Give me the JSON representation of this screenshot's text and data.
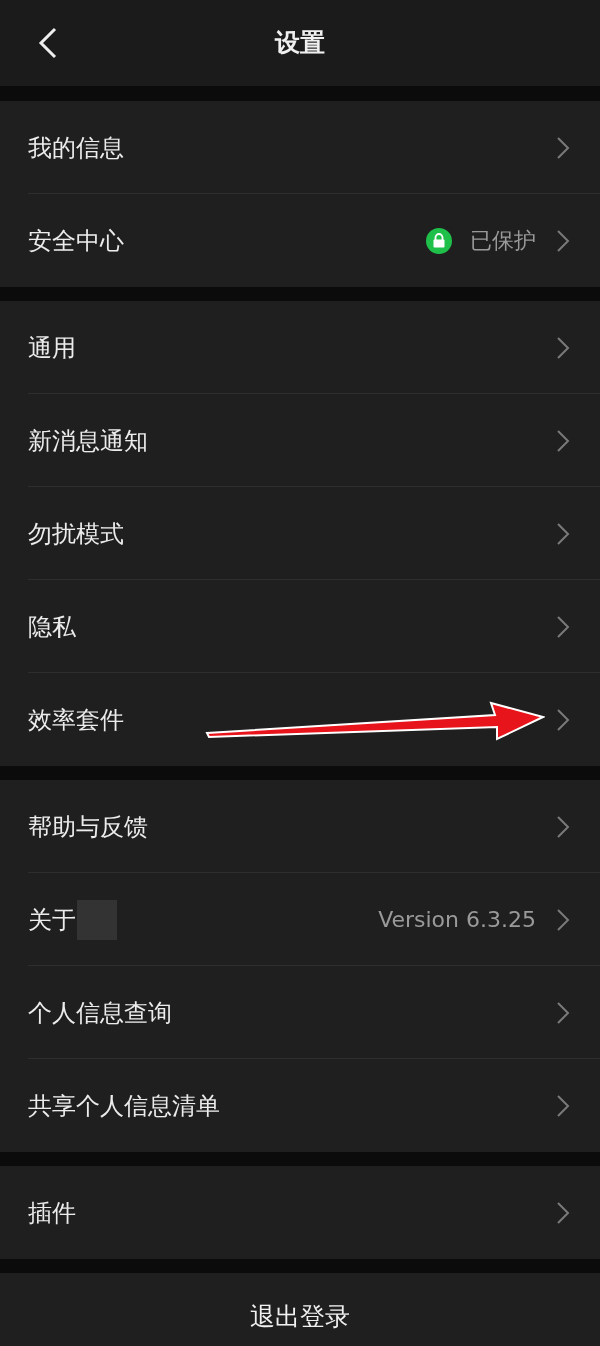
{
  "header": {
    "title": "设置"
  },
  "groups": [
    {
      "rows": [
        {
          "kind": "plain",
          "label": "我的信息"
        },
        {
          "kind": "status",
          "label": "安全中心",
          "value": "已保护"
        }
      ]
    },
    {
      "rows": [
        {
          "kind": "plain",
          "label": "通用"
        },
        {
          "kind": "plain",
          "label": "新消息通知"
        },
        {
          "kind": "plain",
          "label": "勿扰模式"
        },
        {
          "kind": "plain",
          "label": "隐私"
        },
        {
          "kind": "plain",
          "label": "效率套件",
          "annotation": {
            "kind": "arrow"
          }
        }
      ]
    },
    {
      "rows": [
        {
          "kind": "plain",
          "label": "帮助与反馈"
        },
        {
          "kind": "redacted",
          "label": "关于",
          "value": "Version 6.3.25"
        },
        {
          "kind": "plain",
          "label": "个人信息查询"
        },
        {
          "kind": "plain",
          "label": "共享个人信息清单"
        }
      ]
    },
    {
      "rows": [
        {
          "kind": "plain",
          "label": "插件"
        }
      ]
    }
  ],
  "logout": {
    "label": "退出登录"
  }
}
